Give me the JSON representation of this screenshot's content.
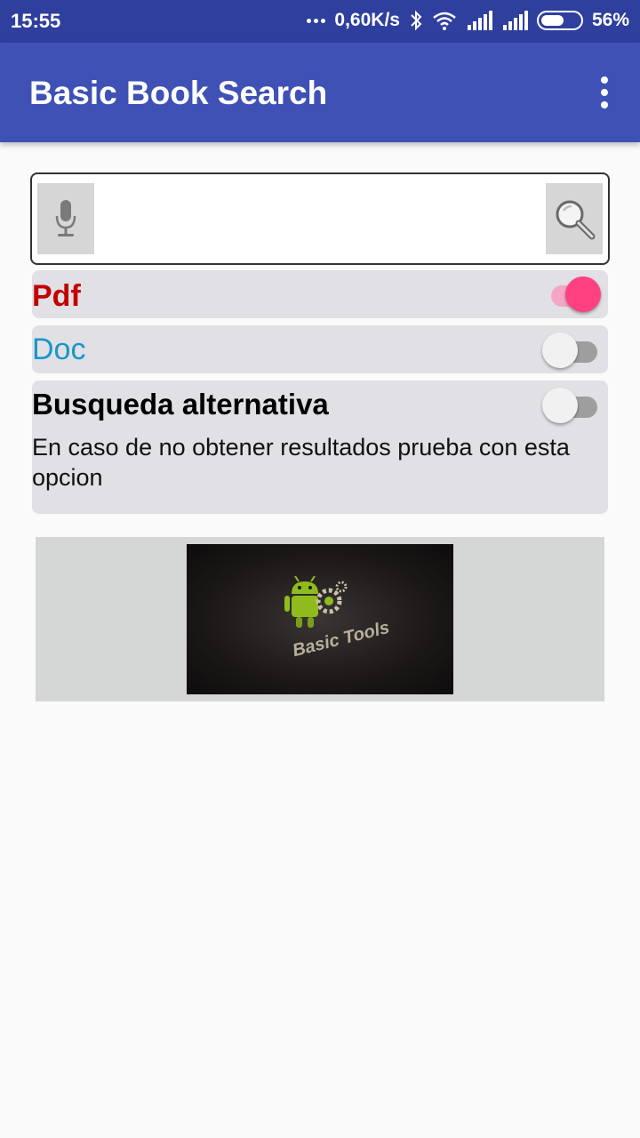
{
  "status_bar": {
    "time": "15:55",
    "network_speed": "0,60K/s",
    "battery_percent": "56%",
    "battery_level": 0.56
  },
  "app_bar": {
    "title": "Basic Book Search"
  },
  "search": {
    "placeholder": "",
    "value": ""
  },
  "options": {
    "pdf": {
      "label": "Pdf",
      "enabled": true,
      "color": "#c20000"
    },
    "doc": {
      "label": "Doc",
      "enabled": false,
      "color": "#1a96c8"
    },
    "alternative": {
      "label": "Busqueda alternativa",
      "description": "En caso de no obtener resultados prueba con esta opcion",
      "enabled": false
    }
  },
  "banner": {
    "logo_text": "Basic Tools"
  },
  "colors": {
    "primary": "#3f51b5",
    "primary_dark": "#2f3f9e",
    "accent": "#ff4081"
  }
}
